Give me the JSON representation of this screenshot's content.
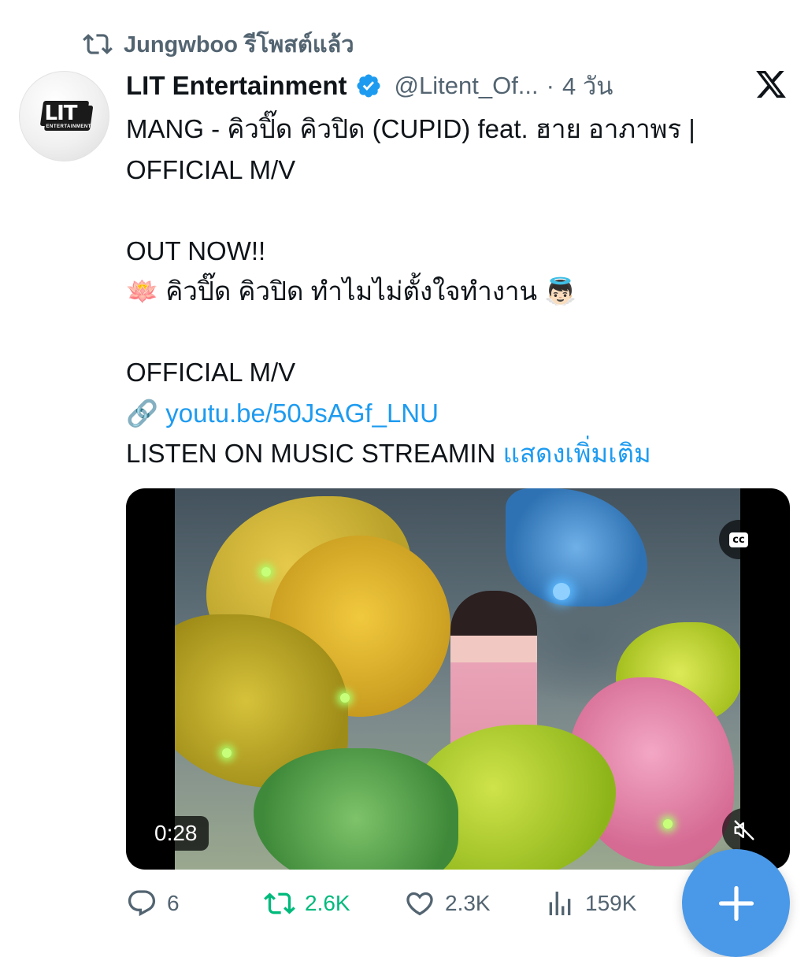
{
  "repost": {
    "icon": "repost-icon",
    "user": "Jungwboo",
    "suffix": "รีโพสต์แล้ว",
    "text": "Jungwboo รีโพสต์แล้ว"
  },
  "author": {
    "avatar_text": "LIT",
    "avatar_sub": "ENTERTAINMENT",
    "display_name": "LIT Entertainment",
    "verified_icon": "verified-badge-icon",
    "handle": "@Litent_Of...",
    "separator": "·",
    "time": "4 วัน"
  },
  "tweet": {
    "line1": "MANG - คิวปิ๊ด คิวปิด (CUPID) feat. ฮาย อาภาพร |",
    "line2": "OFFICIAL M/V",
    "line3": "OUT NOW!!",
    "line4_emoji_start": "🪷",
    "line4_text": "คิวปิ๊ด คิวปิด ทำไมไม่ตั้งใจทำงาน",
    "line4_emoji_end": "👼🏻",
    "line5": "OFFICIAL M/V",
    "link_emoji": "🔗",
    "link_text": "youtu.be/50JsAGf_LNU",
    "line7": "LISTEN ON MUSIC STREAMIN",
    "show_more": "แสดงเพิ่มเติม"
  },
  "media": {
    "duration": "0:28",
    "cc_label": "cc",
    "cc_icon": "closed-captions-icon",
    "mute_icon": "muted-speaker-icon"
  },
  "actions": {
    "reply_count": "6",
    "repost_count": "2.6K",
    "like_count": "2.3K",
    "views_count": "159K"
  },
  "colors": {
    "accent": "#1d9bf0",
    "repost_green": "#00ba7c",
    "muted_text": "#536471",
    "fab": "#4a99e9"
  }
}
